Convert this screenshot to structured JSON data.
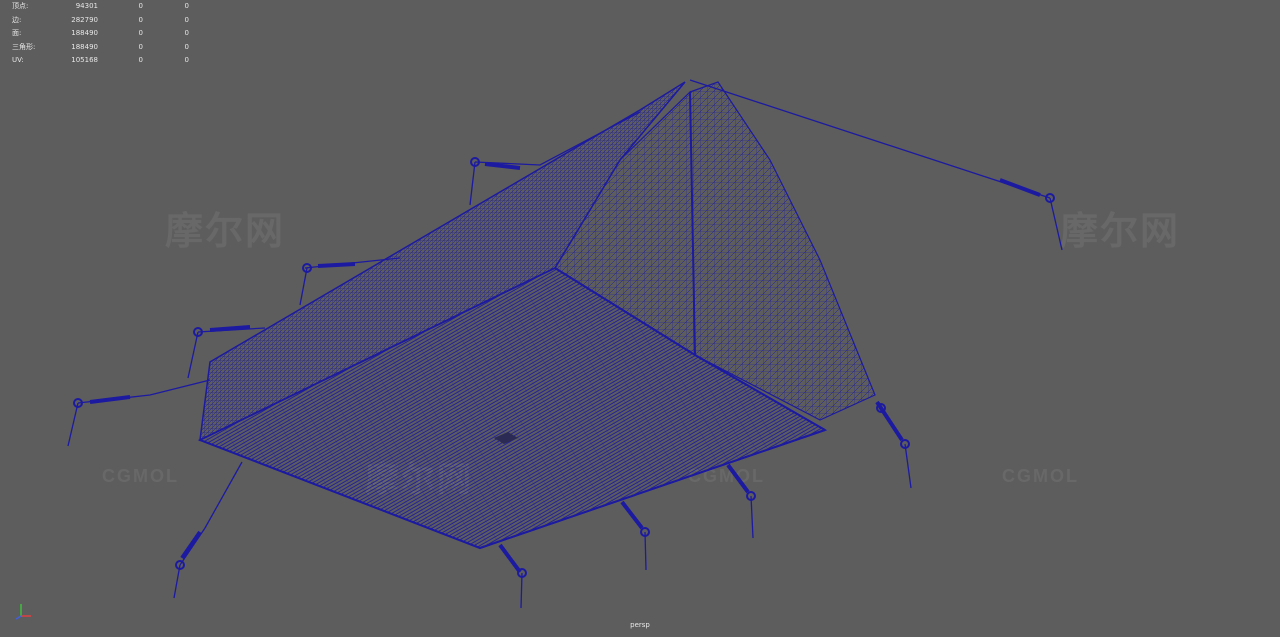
{
  "hud": {
    "rows": [
      {
        "label": "顶点:",
        "v1": "94301",
        "v2": "0",
        "v3": "0"
      },
      {
        "label": "边:",
        "v1": "282790",
        "v2": "0",
        "v3": "0"
      },
      {
        "label": "面:",
        "v1": "188490",
        "v2": "0",
        "v3": "0"
      },
      {
        "label": "三角形:",
        "v1": "188490",
        "v2": "0",
        "v3": "0"
      },
      {
        "label": "UV:",
        "v1": "105168",
        "v2": "0",
        "v3": "0"
      }
    ]
  },
  "viewport": {
    "camera_label": "persp"
  },
  "watermarks": {
    "cgmol": "CGMOL",
    "cn": "摩尔网"
  },
  "colors": {
    "background": "#5d5d5d",
    "wireframe": "#1c1aa0",
    "hud_text": "#e6e6e6"
  },
  "icons": {
    "axis": "axis-gizmo-icon"
  }
}
